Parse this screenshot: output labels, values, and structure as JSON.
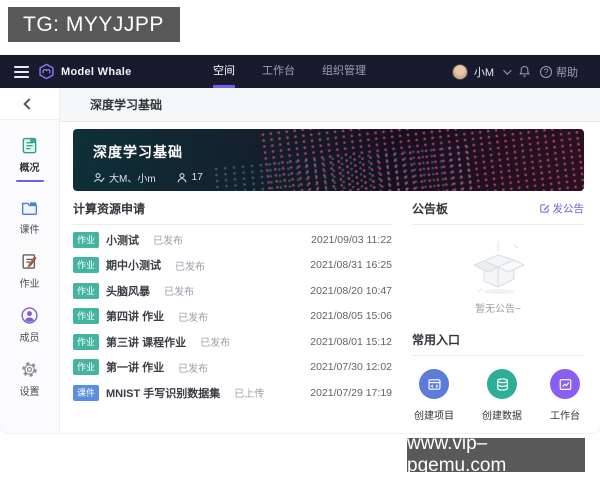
{
  "watermarks": {
    "top": "TG: MYYJJPP",
    "bottom": "www.vip–pgemu.com"
  },
  "navbar": {
    "brand": "Model Whale",
    "items": [
      {
        "label": "空间",
        "active": true
      },
      {
        "label": "工作台",
        "active": false
      },
      {
        "label": "组织管理",
        "active": false
      }
    ],
    "user_name": "小M",
    "help_label": "帮助"
  },
  "sidebar": {
    "items": [
      {
        "label": "概况",
        "icon": "overview-icon",
        "active": true
      },
      {
        "label": "课件",
        "icon": "courseware-icon",
        "active": false
      },
      {
        "label": "作业",
        "icon": "homework-icon",
        "active": false
      },
      {
        "label": "成员",
        "icon": "members-icon",
        "active": false
      },
      {
        "label": "设置",
        "icon": "settings-icon",
        "active": false
      }
    ]
  },
  "page": {
    "title": "深度学习基础"
  },
  "banner": {
    "title": "深度学习基础",
    "managers": "大M、小m",
    "member_count": "17"
  },
  "resources": {
    "title": "计算资源申请",
    "items": [
      {
        "badge": "作业",
        "name": "小测试",
        "status": "已发布",
        "date": "2021/09/03 11:22"
      },
      {
        "badge": "作业",
        "name": "期中小测试",
        "status": "已发布",
        "date": "2021/08/31 16:25"
      },
      {
        "badge": "作业",
        "name": "头脑风暴",
        "status": "已发布",
        "date": "2021/08/20 10:47"
      },
      {
        "badge": "作业",
        "name": "第四讲 作业",
        "status": "已发布",
        "date": "2021/08/05 15:06"
      },
      {
        "badge": "作业",
        "name": "第三讲 课程作业",
        "status": "已发布",
        "date": "2021/08/01 15:12"
      },
      {
        "badge": "作业",
        "name": "第一讲 作业",
        "status": "已发布",
        "date": "2021/07/30 12:02"
      },
      {
        "badge": "课件",
        "name": "MNIST 手写识别数据集",
        "status": "已上传",
        "date": "2021/07/29 17:19"
      }
    ]
  },
  "announcements": {
    "title": "公告板",
    "post_label": "发公告",
    "empty_text": "暂无公告~"
  },
  "shortcuts": {
    "title": "常用入口",
    "items": [
      {
        "label": "创建项目",
        "icon": "project-icon",
        "color": "#5b7dd8"
      },
      {
        "label": "创建数据",
        "icon": "database-icon",
        "color": "#2fae96"
      },
      {
        "label": "工作台",
        "icon": "workbench-icon",
        "color": "#8a5ff0"
      }
    ]
  },
  "colors": {
    "navbar_bg": "#171b2d",
    "accent_purple": "#7c5cde",
    "badge_homework": "#44b3a0",
    "badge_courseware": "#5a8ede",
    "link_purple": "#7460e0"
  }
}
